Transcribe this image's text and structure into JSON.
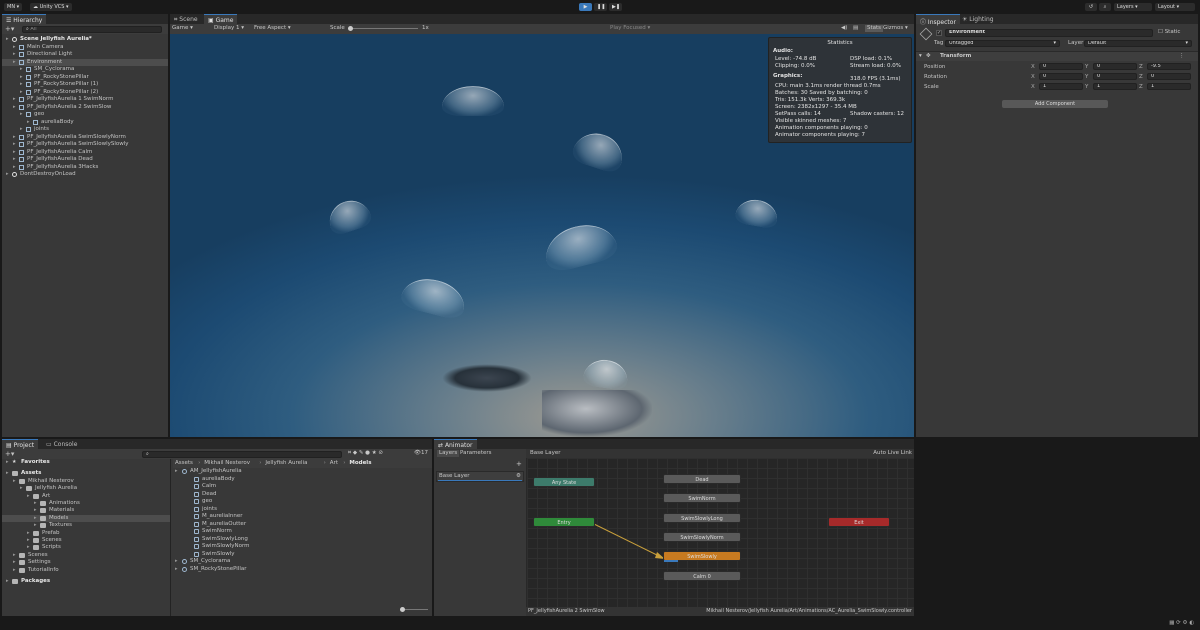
{
  "toolbar": {
    "account": "MN",
    "vcs": "Unity VCS",
    "layers": "Layers",
    "layout": "Layout",
    "icons": [
      "play-icon",
      "pause-icon",
      "step-icon",
      "history-icon",
      "search-icon"
    ]
  },
  "hierarchy": {
    "tab": "Hierarchy",
    "search_placeholder": "All",
    "items": [
      {
        "label": "Scene Jellyfish Aurelia*",
        "indent": 0,
        "bold": true,
        "icon": "scene"
      },
      {
        "label": "Main Camera",
        "indent": 1,
        "icon": "cube"
      },
      {
        "label": "Directional Light",
        "indent": 1,
        "icon": "cube"
      },
      {
        "label": "Environment",
        "indent": 1,
        "icon": "cube",
        "selected": true
      },
      {
        "label": "SM_Cyclorama",
        "indent": 2,
        "icon": "cube"
      },
      {
        "label": "PF_RockyStonePillar",
        "indent": 2,
        "icon": "cube"
      },
      {
        "label": "PF_RockyStonePillar (1)",
        "indent": 2,
        "icon": "cube"
      },
      {
        "label": "PF_RockyStonePillar (2)",
        "indent": 2,
        "icon": "cube"
      },
      {
        "label": "PF_JellyfishAurelia 1 SwimNorm",
        "indent": 1,
        "icon": "cube"
      },
      {
        "label": "PF_JellyfishAurelia 2 SwimSlow",
        "indent": 1,
        "icon": "cube"
      },
      {
        "label": "geo",
        "indent": 2,
        "icon": "cube"
      },
      {
        "label": "aureliaBody",
        "indent": 3,
        "icon": "cube"
      },
      {
        "label": "joints",
        "indent": 2,
        "icon": "cube"
      },
      {
        "label": "PF_JellyfishAurelia SwimSlowlyNorm",
        "indent": 1,
        "icon": "cube"
      },
      {
        "label": "PF_JellyfishAurelia SwimSlowlySlowly",
        "indent": 1,
        "icon": "cube"
      },
      {
        "label": "PF_JellyfishAurelia Calm",
        "indent": 1,
        "icon": "cube"
      },
      {
        "label": "PF_JellyfishAurelia Dead",
        "indent": 1,
        "icon": "cube"
      },
      {
        "label": "PF_JellyfishAurelia 3Hacks",
        "indent": 1,
        "icon": "cube"
      },
      {
        "label": "DontDestroyOnLoad",
        "indent": 0,
        "icon": "scene"
      }
    ]
  },
  "game": {
    "tabs": [
      "Scene",
      "Game"
    ],
    "display_mode": "Game",
    "display": "Display 1",
    "aspect": "Free Aspect",
    "scale_label": "Scale",
    "scale_value": "1x",
    "play_focused": "Play Focused",
    "stats_btn": "Stats",
    "gizmos_btn": "Gizmos"
  },
  "statistics": {
    "title": "Statistics",
    "audio_header": "Audio:",
    "level": "Level: -74.8 dB",
    "clipping": "Clipping: 0.0%",
    "dsp": "DSP load: 0.1%",
    "stream": "Stream load: 0.0%",
    "graphics_header": "Graphics:",
    "fps": "318.0 FPS (3.1ms)",
    "cpu": "CPU: main 3.1ms  render thread 0.7ms",
    "batches": "Batches: 30    Saved by batching: 0",
    "tris": "Tris: 151.3k       Verts: 369.3k",
    "screen": "Screen: 2382x1297 - 35.4 MB",
    "setpass": "SetPass calls: 14",
    "shadow": "Shadow casters: 12",
    "skinned": "Visible skinned meshes: 7",
    "anim": "Animation components playing: 0",
    "animator": "Animator components playing: 7"
  },
  "inspector": {
    "tabs": [
      "Inspector",
      "Lighting"
    ],
    "object_name": "Environment",
    "static_label": "Static",
    "tag_label": "Tag",
    "tag_value": "Untagged",
    "layer_label": "Layer",
    "layer_value": "Default",
    "component": "Transform",
    "rows": [
      {
        "label": "Position",
        "x": "0",
        "y": "0",
        "z": "-9.5"
      },
      {
        "label": "Rotation",
        "x": "0",
        "y": "0",
        "z": "0"
      },
      {
        "label": "Scale",
        "x": "1",
        "y": "1",
        "z": "1"
      }
    ],
    "axis": [
      "X",
      "Y",
      "Z"
    ],
    "add_component": "Add Component"
  },
  "project": {
    "tabs": [
      "Project",
      "Console"
    ],
    "count": "17",
    "tree": [
      {
        "label": "Favorites",
        "indent": 0,
        "bold": true,
        "icon": "star"
      },
      {
        "label": "Assets",
        "indent": 0,
        "bold": true,
        "icon": "folder"
      },
      {
        "label": "Mikhail Nesterov",
        "indent": 1,
        "icon": "folder"
      },
      {
        "label": "Jellyfish Aurelia",
        "indent": 2,
        "icon": "folder"
      },
      {
        "label": "Art",
        "indent": 3,
        "icon": "folder"
      },
      {
        "label": "Animations",
        "indent": 4,
        "icon": "folder"
      },
      {
        "label": "Materials",
        "indent": 4,
        "icon": "folder"
      },
      {
        "label": "Models",
        "indent": 4,
        "icon": "folder",
        "selected": true
      },
      {
        "label": "Textures",
        "indent": 4,
        "icon": "folder"
      },
      {
        "label": "Prefab",
        "indent": 3,
        "icon": "folder"
      },
      {
        "label": "Scenes",
        "indent": 3,
        "icon": "folder"
      },
      {
        "label": "Scripts",
        "indent": 3,
        "icon": "folder"
      },
      {
        "label": "Scenes",
        "indent": 1,
        "icon": "folder"
      },
      {
        "label": "Settings",
        "indent": 1,
        "icon": "folder"
      },
      {
        "label": "TutorialInfo",
        "indent": 1,
        "icon": "folder"
      },
      {
        "label": "Packages",
        "indent": 0,
        "bold": true,
        "icon": "folder"
      }
    ],
    "breadcrumb": [
      "Assets",
      "Mikhail Nesterov",
      "Jellyfish Aurelia",
      "Art",
      "Models"
    ],
    "files": [
      {
        "label": "AM_JellyfishAurelia",
        "indent": 0
      },
      {
        "label": "aureliaBody",
        "indent": 1
      },
      {
        "label": "Calm",
        "indent": 1
      },
      {
        "label": "Dead",
        "indent": 1
      },
      {
        "label": "geo",
        "indent": 1
      },
      {
        "label": "joints",
        "indent": 1
      },
      {
        "label": "M_aureliaInner",
        "indent": 1
      },
      {
        "label": "M_aureliaOutter",
        "indent": 1
      },
      {
        "label": "SwimNorm",
        "indent": 1
      },
      {
        "label": "SwimSlowlyLong",
        "indent": 1
      },
      {
        "label": "SwimSlowlyNorm",
        "indent": 1
      },
      {
        "label": "SwimSlowly",
        "indent": 1
      },
      {
        "label": "SM_Cyclorama",
        "indent": 0
      },
      {
        "label": "SM_RockyStonePillar",
        "indent": 0
      }
    ]
  },
  "animator": {
    "tab": "Animator",
    "sub_tabs": [
      "Layers",
      "Parameters"
    ],
    "breadcrumb": "Base Layer",
    "auto_live_link": "Auto Live Link",
    "layer_name": "Base Layer",
    "nodes": {
      "any_state": "Any State",
      "entry": "Entry",
      "exit": "Exit",
      "dead": "Dead",
      "swim_norm": "SwimNorm",
      "swim_slowly_long": "SwimSlowlyLong",
      "swim_slowly_norm": "SwimSlowlyNorm",
      "swim_slowly": "SwimSlowly",
      "calm": "Calm 0"
    },
    "status_left": "PF_JellyfishAurelia 2 SwimSlow",
    "status_right": "Mikhail Nesterov/Jellyfish Aurelia/Art/Animations/AC_Aurelia_SwimSlowly.controller"
  },
  "colors": {
    "accent": "#3a79bb",
    "node_orange": "#c77a20",
    "node_green": "#2f8a3a",
    "node_red": "#a62a2a",
    "node_teal": "#3d7b6b"
  }
}
